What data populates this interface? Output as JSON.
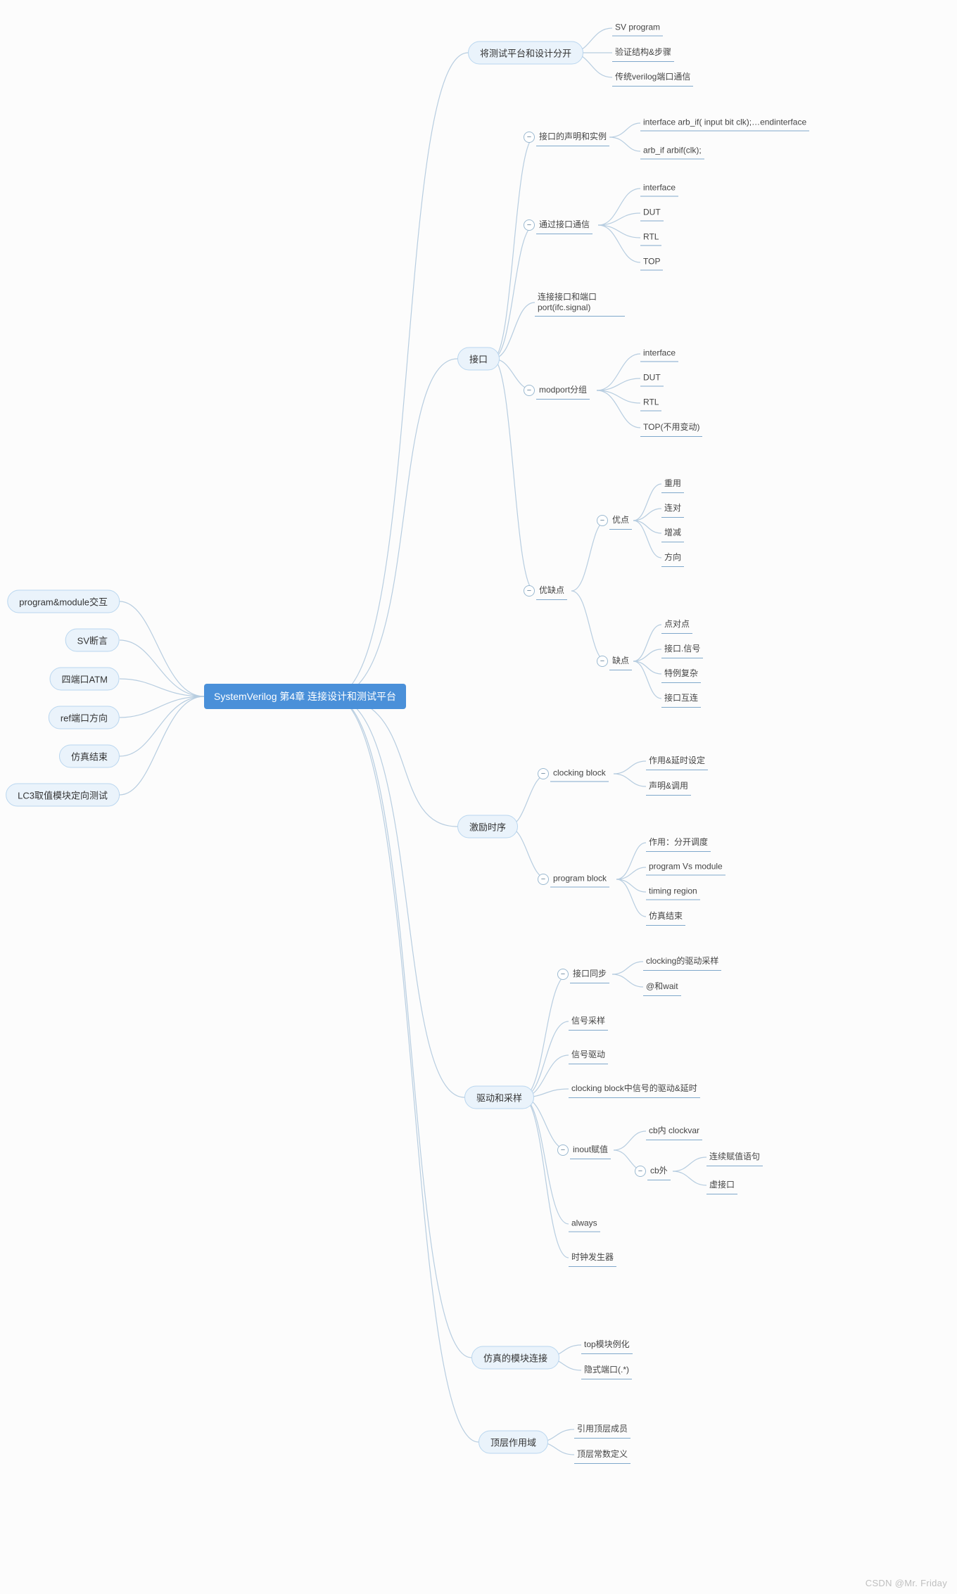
{
  "watermark": "CSDN @Mr. Friday",
  "root": {
    "label": "SystemVerilog 第4章 连接设计和测试平台"
  },
  "left": {
    "n1": "program&module交互",
    "n2": "SV断言",
    "n3": "四端口ATM",
    "n4": "ref端口方向",
    "n5": "仿真结束",
    "n6": "LC3取值模块定向测试"
  },
  "r1": {
    "label": "将测试平台和设计分开",
    "c1": "SV program",
    "c2": "验证结构&步骤",
    "c3": "传统verilog端口通信"
  },
  "r2": {
    "label": "接口",
    "a": {
      "label": "接口的声明和实例",
      "c1": "interface arb_if( input bit clk);…endinterface",
      "c2": "arb_if arbif(clk);"
    },
    "b": {
      "label": "通过接口通信",
      "c1": "interface",
      "c2": "DUT",
      "c3": "RTL",
      "c4": "TOP"
    },
    "c": {
      "label": "连接接口和端口port(ifc.signal)"
    },
    "d": {
      "label": "modport分组",
      "c1": "interface",
      "c2": "DUT",
      "c3": "RTL",
      "c4": "TOP(不用变动)"
    },
    "e": {
      "label": "优缺点",
      "adv": {
        "label": "优点",
        "c1": "重用",
        "c2": "连对",
        "c3": "增减",
        "c4": "方向"
      },
      "dis": {
        "label": "缺点",
        "c1": "点对点",
        "c2": "接口.信号",
        "c3": "特例复杂",
        "c4": "接口互连"
      }
    }
  },
  "r3": {
    "label": "激励时序",
    "a": {
      "label": "clocking block",
      "c1": "作用&延时设定",
      "c2": "声明&调用"
    },
    "b": {
      "label": "program block",
      "c1": "作用：分开调度",
      "c2": "program Vs module",
      "c3": "timing region",
      "c4": "仿真结束"
    }
  },
  "r4": {
    "label": "驱动和采样",
    "a": {
      "label": "接口同步",
      "c1": "clocking的驱动采样",
      "c2": "@和wait"
    },
    "b": "信号采样",
    "c": "信号驱动",
    "d": "clocking block中信号的驱动&延时",
    "e": {
      "label": "inout赋值",
      "c1": "cb内 clockvar",
      "c2": {
        "label": "cb外",
        "c1": "连续赋值语句",
        "c2": "虚接口"
      }
    },
    "f": "always",
    "g": "时钟发生器"
  },
  "r5": {
    "label": "仿真的模块连接",
    "c1": "top模块例化",
    "c2": "隐式端口(.*)"
  },
  "r6": {
    "label": "顶层作用域",
    "c1": "引用顶层成员",
    "c2": "顶层常数定义"
  }
}
